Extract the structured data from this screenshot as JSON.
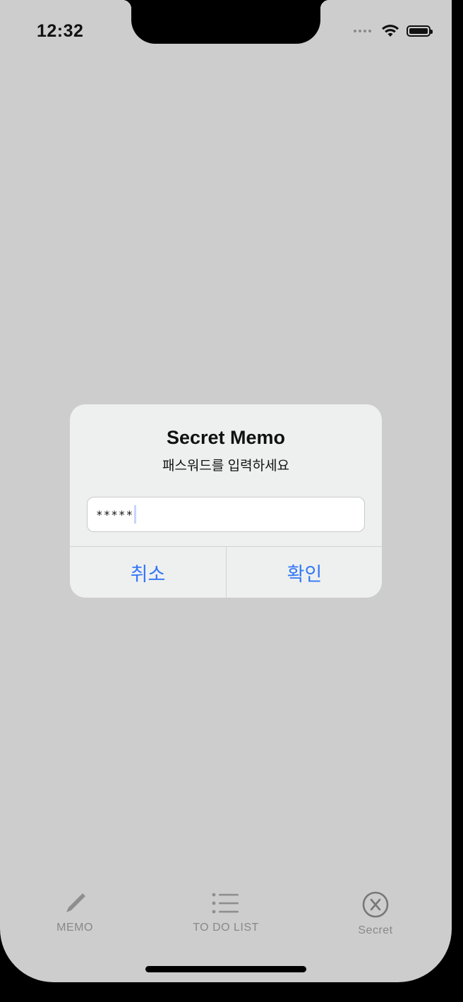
{
  "status_bar": {
    "time": "12:32"
  },
  "alert": {
    "title": "Secret Memo",
    "message": "패스워드를 입력하세요",
    "input_value": "*****",
    "cancel_label": "취소",
    "ok_label": "확인"
  },
  "tab_bar": {
    "items": [
      {
        "label": "MEMO",
        "icon": "pencil-icon"
      },
      {
        "label": "TO DO LIST",
        "icon": "list-icon"
      },
      {
        "label": "Secret",
        "icon": "x-circle-icon"
      }
    ]
  },
  "colors": {
    "background": "#cdcdcd",
    "alert_background": "#eef0f0",
    "accent": "#3478f6",
    "tab_inactive": "#888888"
  }
}
